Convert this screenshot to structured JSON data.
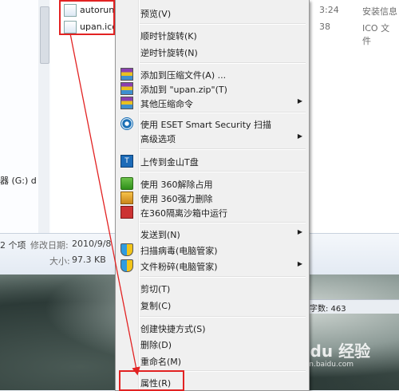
{
  "files": [
    {
      "name": "autorun",
      "date": "3:24",
      "type": "安装信息"
    },
    {
      "name": "upan.ico",
      "date": "38",
      "type": "ICO 文件"
    }
  ],
  "left_pane": {
    "drive_label": "器 (G:) d"
  },
  "details": {
    "count": "2 个项",
    "modified_label": "修改日期:",
    "modified_value": "2010/9/8",
    "size_label": "大小:",
    "size_value": "97.3 KB"
  },
  "status": {
    "chars": "字数: 463"
  },
  "watermark": {
    "brand": "Bai du 经验",
    "url": "jingyan.baidu.com"
  },
  "menu": {
    "preview": "预览(V)",
    "rotate_cw": "顺时针旋转(K)",
    "rotate_ccw": "逆时针旋转(N)",
    "add_archive": "添加到压缩文件(A) ...",
    "add_zip": "添加到 \"upan.zip\"(T)",
    "other_compress": "其他压缩命令",
    "eset_scan": "使用 ESET Smart Security 扫描",
    "advanced": "高级选项",
    "upload_kuaipan": "上传到金山T盘",
    "unlock_360": "使用 360解除占用",
    "force_delete_360": "使用 360强力删除",
    "sandbox_360": "在360隔离沙箱中运行",
    "send_to": "发送到(N)",
    "scan_virus": "扫描病毒(电脑管家)",
    "shred": "文件粉碎(电脑管家)",
    "cut": "剪切(T)",
    "copy": "复制(C)",
    "create_shortcut": "创建快捷方式(S)",
    "delete": "删除(D)",
    "rename": "重命名(M)",
    "properties": "属性(R)"
  },
  "icons": {
    "zip": "winrar-icon",
    "eset": "eset-icon",
    "kuaipan": "kuaipan-icon",
    "360": "360-icon",
    "pcmgr": "pc-manager-shield-icon"
  },
  "colors": {
    "highlight_border": "#e22222",
    "menu_bg": "#f0f0f0"
  }
}
